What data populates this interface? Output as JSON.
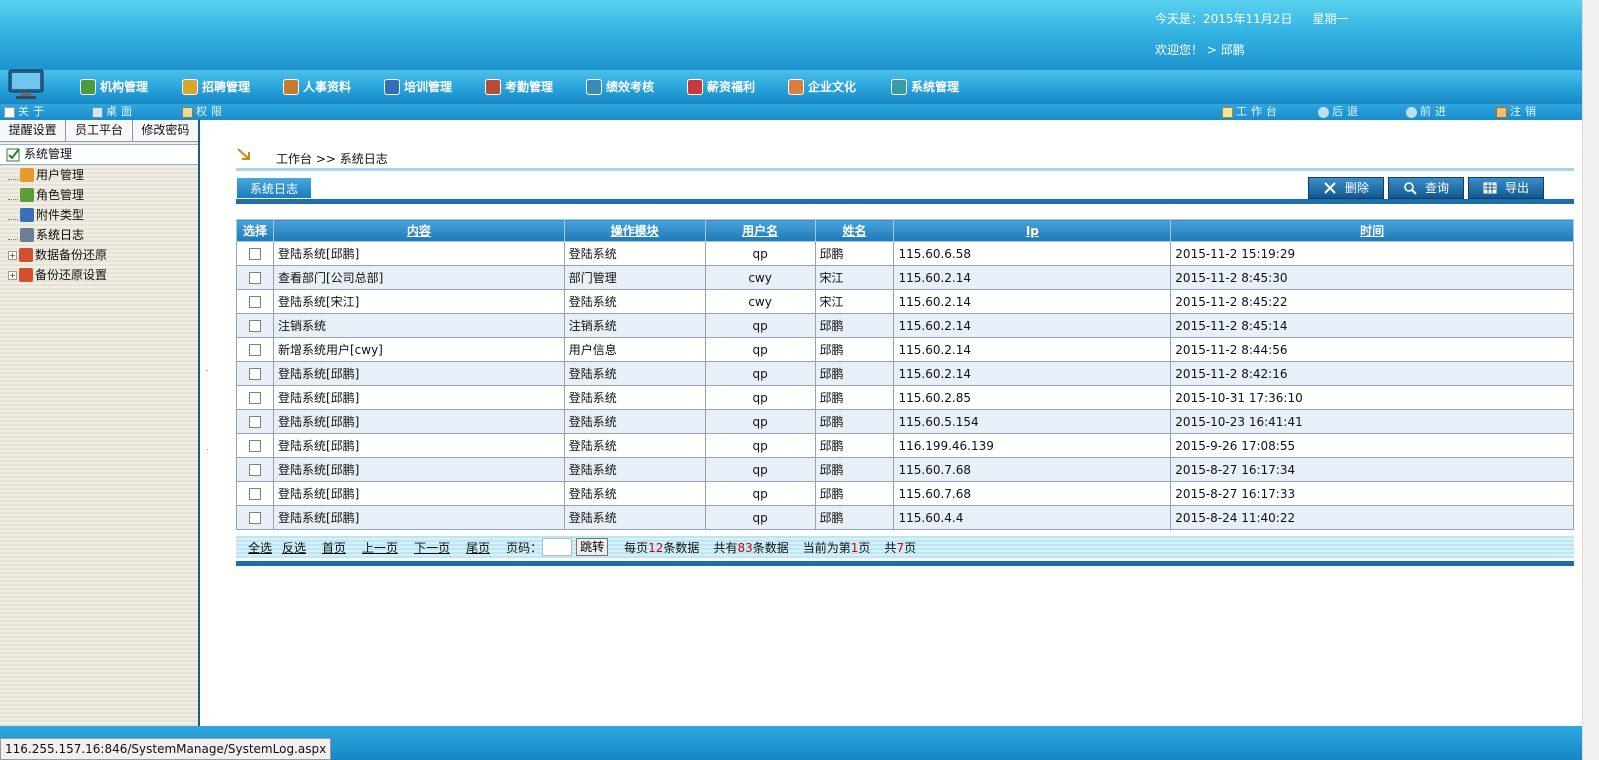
{
  "header": {
    "date_label": "今天是：2015年11月2日",
    "weekday": "星期一",
    "welcome": "欢迎您！ > 邱鹏"
  },
  "menu": {
    "items": [
      {
        "label": "机构管理",
        "icon": "org-icon"
      },
      {
        "label": "招聘管理",
        "icon": "recruit-icon"
      },
      {
        "label": "人事资料",
        "icon": "personnel-icon"
      },
      {
        "label": "培训管理",
        "icon": "training-icon"
      },
      {
        "label": "考勤管理",
        "icon": "attendance-icon"
      },
      {
        "label": "绩效考核",
        "icon": "performance-icon"
      },
      {
        "label": "薪资福利",
        "icon": "salary-icon"
      },
      {
        "label": "企业文化",
        "icon": "culture-icon"
      },
      {
        "label": "系统管理",
        "icon": "system-icon"
      }
    ]
  },
  "subbar": {
    "about": "关于",
    "desktop": "桌面",
    "permission": "权限",
    "workbench": "工作台",
    "back": "后退",
    "forward": "前进",
    "logout": "注销"
  },
  "left": {
    "tabs": [
      "提醒设置",
      "员工平台",
      "修改密码"
    ],
    "root": "系统管理",
    "nodes": [
      {
        "label": "用户管理",
        "icon": "users-icon",
        "expandable": false
      },
      {
        "label": "角色管理",
        "icon": "role-icon",
        "expandable": false
      },
      {
        "label": "附件类型",
        "icon": "attachment-icon",
        "expandable": false
      },
      {
        "label": "系统日志",
        "icon": "log-icon",
        "expandable": false
      },
      {
        "label": "数据备份还原",
        "icon": "backup-icon",
        "expandable": true
      },
      {
        "label": "备份还原设置",
        "icon": "backup-settings-icon",
        "expandable": true
      }
    ]
  },
  "main": {
    "breadcrumb": "工作台 >> 系统日志",
    "title_tab": "系统日志",
    "buttons": {
      "delete": "删除",
      "query": "查询",
      "export": "导出"
    },
    "columns": [
      "选择",
      "内容",
      "操作模块",
      "用户名",
      "姓名",
      "Ip",
      "时间"
    ],
    "rows": [
      {
        "content": "登陆系统[邱鹏]",
        "module": "登陆系统",
        "user": "qp",
        "name": "邱鹏",
        "ip": "115.60.6.58",
        "time": "2015-11-2 15:19:29"
      },
      {
        "content": "查看部门[公司总部]",
        "module": "部门管理",
        "user": "cwy",
        "name": "宋江",
        "ip": "115.60.2.14",
        "time": "2015-11-2 8:45:30"
      },
      {
        "content": "登陆系统[宋江]",
        "module": "登陆系统",
        "user": "cwy",
        "name": "宋江",
        "ip": "115.60.2.14",
        "time": "2015-11-2 8:45:22"
      },
      {
        "content": "注销系统",
        "module": "注销系统",
        "user": "qp",
        "name": "邱鹏",
        "ip": "115.60.2.14",
        "time": "2015-11-2 8:45:14"
      },
      {
        "content": "新增系统用户[cwy]",
        "module": "用户信息",
        "user": "qp",
        "name": "邱鹏",
        "ip": "115.60.2.14",
        "time": "2015-11-2 8:44:56"
      },
      {
        "content": "登陆系统[邱鹏]",
        "module": "登陆系统",
        "user": "qp",
        "name": "邱鹏",
        "ip": "115.60.2.14",
        "time": "2015-11-2 8:42:16"
      },
      {
        "content": "登陆系统[邱鹏]",
        "module": "登陆系统",
        "user": "qp",
        "name": "邱鹏",
        "ip": "115.60.2.85",
        "time": "2015-10-31 17:36:10"
      },
      {
        "content": "登陆系统[邱鹏]",
        "module": "登陆系统",
        "user": "qp",
        "name": "邱鹏",
        "ip": "115.60.5.154",
        "time": "2015-10-23 16:41:41"
      },
      {
        "content": "登陆系统[邱鹏]",
        "module": "登陆系统",
        "user": "qp",
        "name": "邱鹏",
        "ip": "116.199.46.139",
        "time": "2015-9-26 17:08:55"
      },
      {
        "content": "登陆系统[邱鹏]",
        "module": "登陆系统",
        "user": "qp",
        "name": "邱鹏",
        "ip": "115.60.7.68",
        "time": "2015-8-27 16:17:34"
      },
      {
        "content": "登陆系统[邱鹏]",
        "module": "登陆系统",
        "user": "qp",
        "name": "邱鹏",
        "ip": "115.60.7.68",
        "time": "2015-8-27 16:17:33"
      },
      {
        "content": "登陆系统[邱鹏]",
        "module": "登陆系统",
        "user": "qp",
        "name": "邱鹏",
        "ip": "115.60.4.4",
        "time": "2015-8-24 11:40:22"
      }
    ],
    "pager": {
      "select_all": "全选",
      "invert": "反选",
      "first": "首页",
      "prev": "上一页",
      "next": "下一页",
      "last": "尾页",
      "page_label": "页码：",
      "page_input": "",
      "jump": "跳转",
      "per_page_pre": "每页",
      "per_page": "12",
      "per_page_post": "条数据",
      "total_pre": "共有",
      "total": "83",
      "total_post": "条数据",
      "current_pre": "当前为第",
      "current": "1",
      "current_post": "页",
      "pages_pre": "共",
      "pages": "7",
      "pages_post": "页"
    }
  },
  "status": {
    "url": "116.255.157.16:846/SystemManage/SystemLog.aspx"
  },
  "colors": {
    "accent": "#1c6fa8",
    "header_top": "#5bd2ef",
    "alt_row": "#e9eff7",
    "highlight_number": "#d00000"
  }
}
